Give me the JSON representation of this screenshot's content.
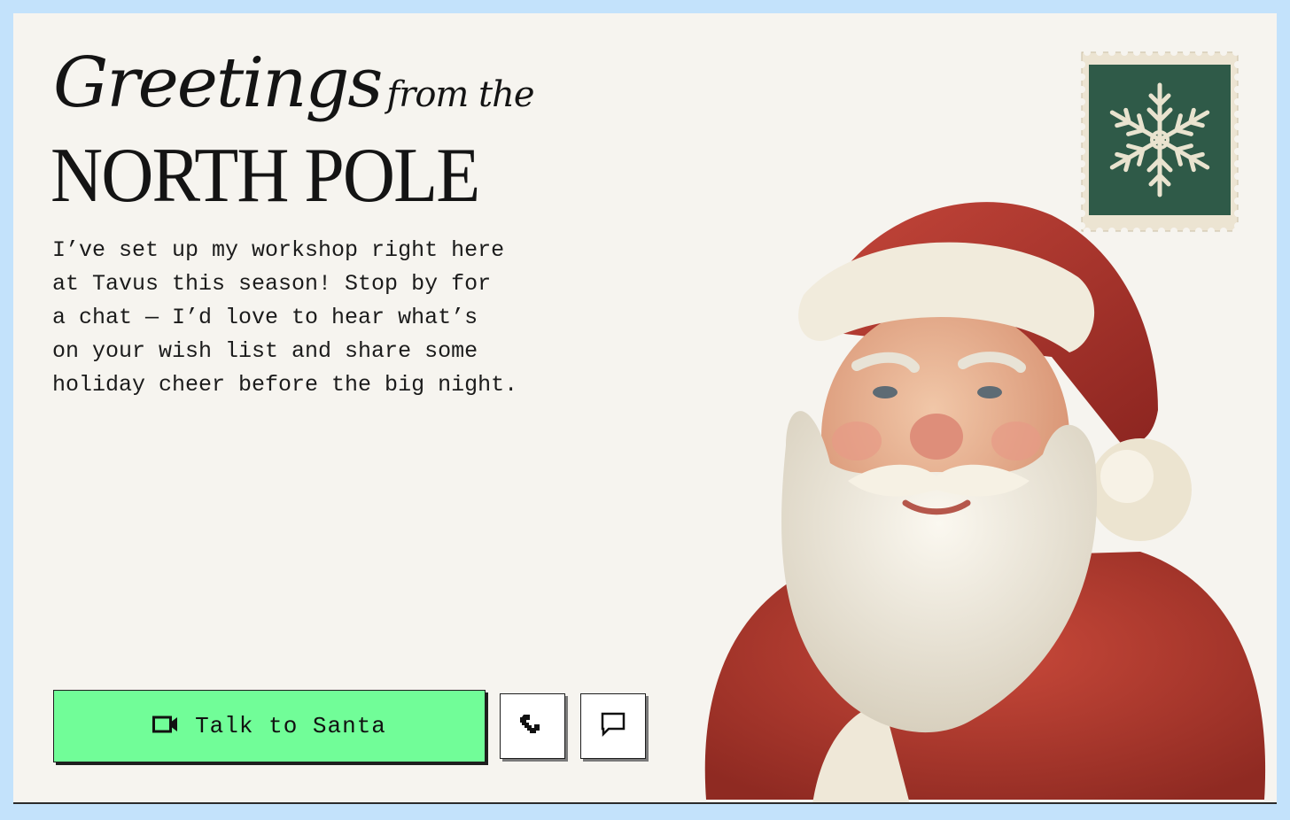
{
  "hero": {
    "title_script": "Greetings",
    "title_small": "from the",
    "title_caps": "NORTH POLE",
    "intro": "I’ve set up my workshop right here\nat Tavus this season! Stop by for\na chat — I’d love to hear what’s\non your wish list and share some\nholiday cheer before the big night."
  },
  "actions": {
    "primary_label": "Talk to Santa",
    "primary_icon": "video-camera-icon",
    "secondary_icons": [
      "phone-icon",
      "chat-bubble-icon"
    ]
  },
  "decor": {
    "stamp_icon": "snowflake-icon",
    "illustration": "santa-illustration"
  },
  "colors": {
    "page_bg": "#c3e2fb",
    "card_bg": "#f6f4ef",
    "primary_button": "#71fd98",
    "stamp_green": "#2f5a48",
    "santa_red": "#b23a2c"
  }
}
